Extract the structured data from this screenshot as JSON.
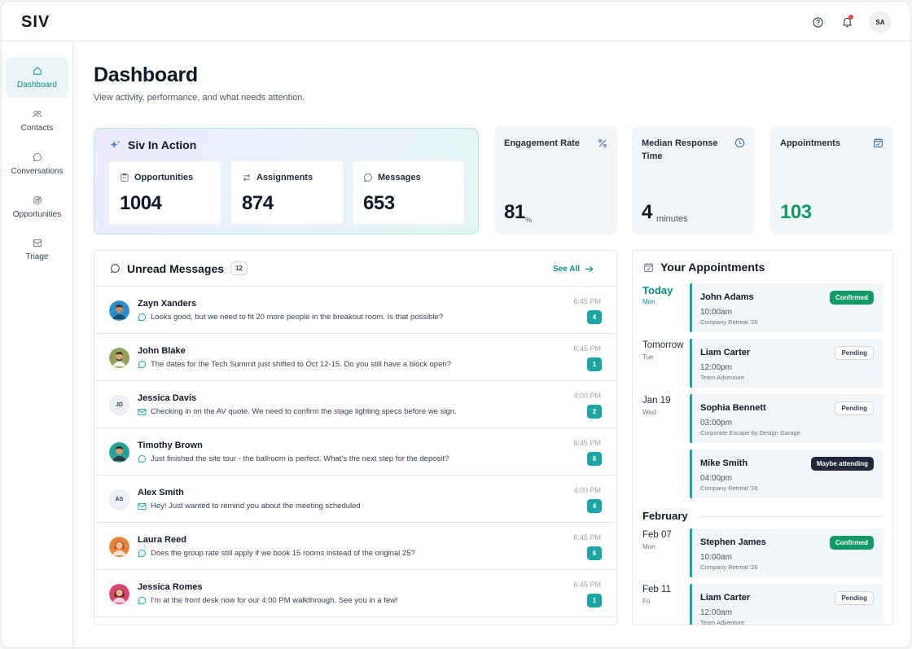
{
  "app": {
    "logo": "SIV",
    "user_initials": "SA"
  },
  "sidebar": {
    "items": [
      {
        "label": "Dashboard",
        "icon": "home-icon",
        "active": true
      },
      {
        "label": "Contacts",
        "icon": "contacts-icon"
      },
      {
        "label": "Conversations",
        "icon": "chat-bubble-icon"
      },
      {
        "label": "Opportunities",
        "icon": "target-icon"
      },
      {
        "label": "Triage",
        "icon": "inbox-icon"
      }
    ]
  },
  "header": {
    "title": "Dashboard",
    "subtitle": "View activity, performance, and what needs attention."
  },
  "siv_in_action": {
    "title": "Siv In Action",
    "cards": [
      {
        "label": "Opportunities",
        "value": "1004",
        "icon": "clipboard-icon"
      },
      {
        "label": "Assignments",
        "value": "874",
        "icon": "swap-arrows-icon"
      },
      {
        "label": "Messages",
        "value": "653",
        "icon": "chat-bubble-icon"
      }
    ]
  },
  "stats": [
    {
      "label": "Engagement Rate",
      "value": "81",
      "unit": "%",
      "icon": "percent-icon"
    },
    {
      "label": "Median Response Time",
      "value": "4",
      "unit": "minutes",
      "icon": "clock-icon"
    },
    {
      "label": "Appointments",
      "value": "103",
      "unit": "",
      "icon": "calendar-check-icon"
    }
  ],
  "unread": {
    "title": "Unread Messages",
    "count": "12",
    "see_all": "See All",
    "messages": [
      {
        "name": "Zayn Xanders",
        "text": "Looks good, but we need to fit 20 more people in the breakout room. Is that possible?",
        "time": "6:45 PM",
        "count": "4",
        "channel": "chat",
        "avatar": "photo",
        "initials": ""
      },
      {
        "name": "John Blake",
        "text": "The dates for the Tech Summit just shifted to Oct 12-15. Do you still have a block open?",
        "time": "6:45 PM",
        "count": "1",
        "channel": "chat",
        "avatar": "photo",
        "initials": ""
      },
      {
        "name": "Jessica Davis",
        "text": "Checking in on the AV quote. We need to confirm the stage lighting specs before we sign.",
        "time": "4:00 PM",
        "count": "2",
        "channel": "email",
        "avatar": "initials",
        "initials": "JD"
      },
      {
        "name": "Timothy Brown",
        "text": "Just finished the site tour - the ballroom is perfect. What’s the next step for the deposit?",
        "time": "6:45 PM",
        "count": "6",
        "channel": "chat",
        "avatar": "photo",
        "initials": ""
      },
      {
        "name": "Alex Smith",
        "text": "Hey! Just wanted to remind you about the meeting scheduled",
        "time": "4:00 PM",
        "count": "4",
        "channel": "email",
        "avatar": "initials",
        "initials": "AS"
      },
      {
        "name": "Laura Reed",
        "text": "Does the group rate still apply if we book 15 rooms instead of the original 25?",
        "time": "6:45 PM",
        "count": "6",
        "channel": "chat",
        "avatar": "photo",
        "initials": ""
      },
      {
        "name": "Jessica Romes",
        "text": "I’m at the front desk now for our 4:00 PM walkthrough. See you in a few!",
        "time": "6:45 PM",
        "count": "1",
        "channel": "chat",
        "avatar": "photo",
        "initials": ""
      }
    ]
  },
  "appointments": {
    "title": "Your Appointments",
    "month_heading": "February",
    "days": [
      {
        "day": "Today",
        "weekday": "Mon"
      },
      {
        "day": "Tomorrow",
        "weekday": "Tue"
      },
      {
        "day": "Jan 19",
        "weekday": "Wed"
      },
      {
        "day": "Feb 07",
        "weekday": "Mon"
      },
      {
        "day": "Feb 11",
        "weekday": "Fri"
      }
    ],
    "items": [
      {
        "name": "John Adams",
        "time": "10:00am",
        "event": "Company Retreat '26",
        "status": "Confirmed"
      },
      {
        "name": "Liam Carter",
        "time": "12:00pm",
        "event": "Team Adventure",
        "status": "Pending"
      },
      {
        "name": "Sophia Bennett",
        "time": "03:00pm",
        "event": "Corporate Escape by Design Garage",
        "status": "Pending"
      },
      {
        "name": "Mike Smith",
        "time": "04:00pm",
        "event": "Company Retreat '26",
        "status": "Maybe attending"
      },
      {
        "name": "Stephen James",
        "time": "10:00am",
        "event": "Company Retreat '26",
        "status": "Confirmed"
      },
      {
        "name": "Liam Carter",
        "time": "12:00am",
        "event": "Team Adventure",
        "status": "Pending"
      }
    ]
  },
  "colors": {
    "accent": "#1aa6a6",
    "success": "#0f9a66",
    "dark": "#1f2937"
  }
}
